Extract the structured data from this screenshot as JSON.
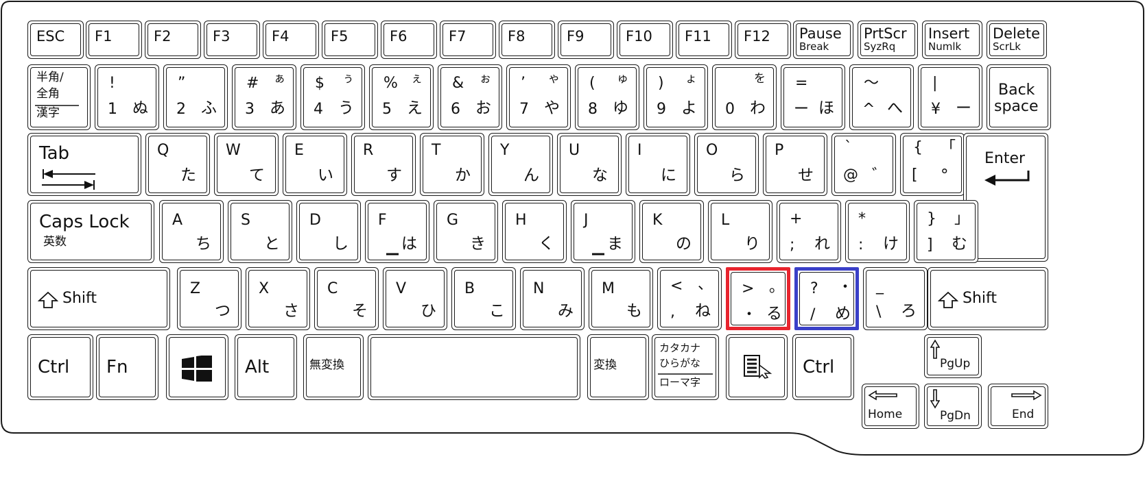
{
  "keyboard": {
    "rows": {
      "function": [
        {
          "id": "esc",
          "main": "ESC"
        },
        {
          "id": "f1",
          "main": "F1"
        },
        {
          "id": "f2",
          "main": "F2"
        },
        {
          "id": "f3",
          "main": "F3"
        },
        {
          "id": "f4",
          "main": "F4"
        },
        {
          "id": "f5",
          "main": "F5"
        },
        {
          "id": "f6",
          "main": "F6"
        },
        {
          "id": "f7",
          "main": "F7"
        },
        {
          "id": "f8",
          "main": "F8"
        },
        {
          "id": "f9",
          "main": "F9"
        },
        {
          "id": "f10",
          "main": "F10"
        },
        {
          "id": "f11",
          "main": "F11"
        },
        {
          "id": "f12",
          "main": "F12"
        },
        {
          "id": "pause",
          "main": "Pause",
          "sub": "Break"
        },
        {
          "id": "prtscr",
          "main": "PrtScr",
          "sub": "SyzRq"
        },
        {
          "id": "insert",
          "main": "Insert",
          "sub": "Numlk"
        },
        {
          "id": "delete",
          "main": "Delete",
          "sub": "ScrLk"
        }
      ],
      "number": [
        {
          "id": "hankaku",
          "top": "半角/",
          "mid": "全角",
          "bot": "漢字"
        },
        {
          "id": "1",
          "ts": "!",
          "tk": "",
          "bs": "1",
          "bk": "ぬ"
        },
        {
          "id": "2",
          "ts": "”",
          "tk": "",
          "bs": "2",
          "bk": "ふ"
        },
        {
          "id": "3",
          "ts": "#",
          "tk": "ぁ",
          "bs": "3",
          "bk": "あ"
        },
        {
          "id": "4",
          "ts": "$",
          "tk": "ぅ",
          "bs": "4",
          "bk": "う"
        },
        {
          "id": "5",
          "ts": "%",
          "tk": "ぇ",
          "bs": "5",
          "bk": "え"
        },
        {
          "id": "6",
          "ts": "&",
          "tk": "ぉ",
          "bs": "6",
          "bk": "お"
        },
        {
          "id": "7",
          "ts": "’",
          "tk": "ゃ",
          "bs": "7",
          "bk": "や"
        },
        {
          "id": "8",
          "ts": "(",
          "tk": "ゅ",
          "bs": "8",
          "bk": "ゆ"
        },
        {
          "id": "9",
          "ts": ")",
          "tk": "ょ",
          "bs": "9",
          "bk": "よ"
        },
        {
          "id": "0",
          "ts": "",
          "tk": "を",
          "bs": "0",
          "bk": "わ"
        },
        {
          "id": "minus",
          "ts": "=",
          "tk": "",
          "bs": "ー",
          "bk": "ほ"
        },
        {
          "id": "caret",
          "ts": "～",
          "tk": "",
          "bs": "^",
          "bk": "へ"
        },
        {
          "id": "yen",
          "ts": "|",
          "tk": "",
          "bs": "¥",
          "bk": "ー"
        },
        {
          "id": "backspace",
          "main": "Back",
          "sub": "space"
        }
      ],
      "qwerty": [
        {
          "id": "tab",
          "main": "Tab"
        },
        {
          "id": "q",
          "letter": "Q",
          "kana": "た"
        },
        {
          "id": "w",
          "letter": "W",
          "kana": "て"
        },
        {
          "id": "e",
          "letter": "E",
          "kana": "い"
        },
        {
          "id": "r",
          "letter": "R",
          "kana": "す"
        },
        {
          "id": "t",
          "letter": "T",
          "kana": "か"
        },
        {
          "id": "y",
          "letter": "Y",
          "kana": "ん"
        },
        {
          "id": "u",
          "letter": "U",
          "kana": "な"
        },
        {
          "id": "i",
          "letter": "I",
          "kana": "に"
        },
        {
          "id": "o",
          "letter": "O",
          "kana": "ら"
        },
        {
          "id": "p",
          "letter": "P",
          "kana": "せ"
        },
        {
          "id": "at",
          "ts": "`",
          "tk": "",
          "bs": "@",
          "bk": "゛"
        },
        {
          "id": "bracket-open",
          "ts": "{",
          "tk": "「",
          "bs": "[",
          "bk": "°"
        },
        {
          "id": "enter",
          "main": "Enter"
        }
      ],
      "home": [
        {
          "id": "caps",
          "main": "Caps Lock",
          "sub": "英数"
        },
        {
          "id": "a",
          "letter": "A",
          "kana": "ち"
        },
        {
          "id": "s",
          "letter": "S",
          "kana": "と"
        },
        {
          "id": "d",
          "letter": "D",
          "kana": "し"
        },
        {
          "id": "f",
          "letter": "F",
          "kana": "は"
        },
        {
          "id": "g",
          "letter": "G",
          "kana": "き"
        },
        {
          "id": "h",
          "letter": "H",
          "kana": "く"
        },
        {
          "id": "j",
          "letter": "J",
          "kana": "ま"
        },
        {
          "id": "k",
          "letter": "K",
          "kana": "の"
        },
        {
          "id": "l",
          "letter": "L",
          "kana": "り"
        },
        {
          "id": "semicolon",
          "ts": "+",
          "tk": "",
          "bs": ";",
          "bk": "れ"
        },
        {
          "id": "colon",
          "ts": "*",
          "tk": "",
          "bs": ":",
          "bk": "け"
        },
        {
          "id": "bracket-close",
          "ts": "}",
          "tk": "」",
          "bs": "]",
          "bk": "む"
        }
      ],
      "shift": [
        {
          "id": "lshift",
          "main": "Shift"
        },
        {
          "id": "z",
          "letter": "Z",
          "kana": "つ"
        },
        {
          "id": "x",
          "letter": "X",
          "kana": "さ"
        },
        {
          "id": "c",
          "letter": "C",
          "kana": "そ"
        },
        {
          "id": "v",
          "letter": "V",
          "kana": "ひ"
        },
        {
          "id": "b",
          "letter": "B",
          "kana": "こ"
        },
        {
          "id": "n",
          "letter": "N",
          "kana": "み"
        },
        {
          "id": "m",
          "letter": "M",
          "kana": "も"
        },
        {
          "id": "comma",
          "ts": "<",
          "tk": "、",
          "bs": ",",
          "bk": "ね"
        },
        {
          "id": "period",
          "ts": ">",
          "tk": "。",
          "bs": "・",
          "bk": "る",
          "highlight": "#e8242e"
        },
        {
          "id": "slash",
          "ts": "?",
          "tk": "・",
          "bs": "/",
          "bk": "め",
          "highlight": "#3a40c8"
        },
        {
          "id": "backslash",
          "ts": "_",
          "tk": "",
          "bs": "\\",
          "bk": "ろ"
        },
        {
          "id": "rshift",
          "main": "Shift"
        }
      ],
      "bottom": [
        {
          "id": "lctrl",
          "main": "Ctrl"
        },
        {
          "id": "fn",
          "main": "Fn"
        },
        {
          "id": "win",
          "icon": "windows-logo-icon"
        },
        {
          "id": "alt",
          "main": "Alt"
        },
        {
          "id": "muhenkan",
          "main": "無変換"
        },
        {
          "id": "space",
          "main": ""
        },
        {
          "id": "henkan",
          "main": "変換"
        },
        {
          "id": "kana",
          "top": "カタカナ",
          "mid": "ひらがな",
          "bot": "ローマ字"
        },
        {
          "id": "app",
          "icon": "application-menu-icon"
        },
        {
          "id": "rctrl",
          "main": "Ctrl"
        }
      ],
      "nav": [
        {
          "id": "pgup",
          "main": "PgUp"
        },
        {
          "id": "home",
          "main": "Home"
        },
        {
          "id": "pgdn",
          "main": "PgDn"
        },
        {
          "id": "end",
          "main": "End"
        }
      ]
    },
    "colors": {
      "outline": "#1a1a1a",
      "highlight_red": "#e8242e",
      "highlight_blue": "#3a40c8",
      "background": "#ffffff"
    }
  }
}
